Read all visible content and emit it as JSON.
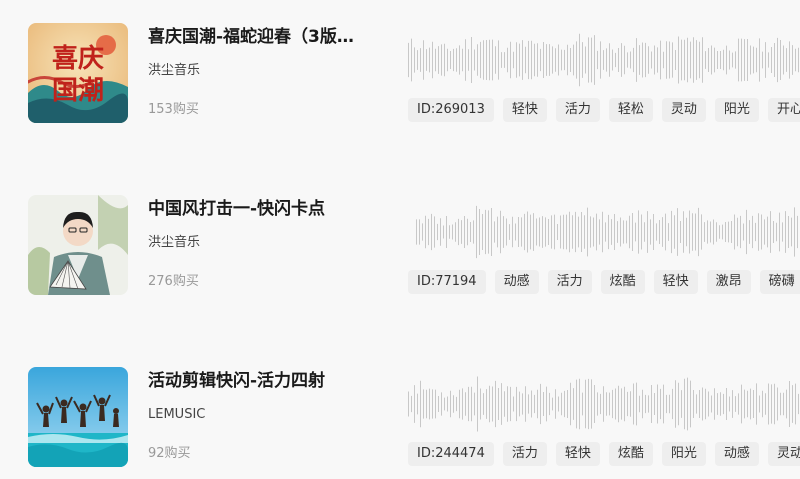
{
  "tracks": [
    {
      "title": "喜庆国潮-福蛇迎春（3版…",
      "author": "洪尘音乐",
      "purchases": "153购买",
      "id_label": "ID:269013",
      "tags": [
        "轻快",
        "活力",
        "轻松",
        "灵动",
        "阳光",
        "开心"
      ],
      "cover_icon": "guochao-poster-cover",
      "cover_text": "喜庆国潮"
    },
    {
      "title": "中国风打击一-快闪卡点",
      "author": "洪尘音乐",
      "purchases": "276购买",
      "id_label": "ID:77194",
      "tags": [
        "动感",
        "活力",
        "炫酷",
        "轻快",
        "激昂",
        "磅礴"
      ],
      "cover_icon": "fan-performer-cover"
    },
    {
      "title": "活动剪辑快闪-活力四射",
      "author": "LEMUSIC",
      "purchases": "92购买",
      "id_label": "ID:244474",
      "tags": [
        "活力",
        "轻快",
        "炫酷",
        "阳光",
        "动感",
        "灵动"
      ],
      "cover_icon": "beach-jumping-cover"
    }
  ],
  "colors": {
    "background": "#f8f8f8",
    "tag_bg": "#eeeeee",
    "waveform": "#c8c8c8",
    "muted_text": "#999999"
  }
}
